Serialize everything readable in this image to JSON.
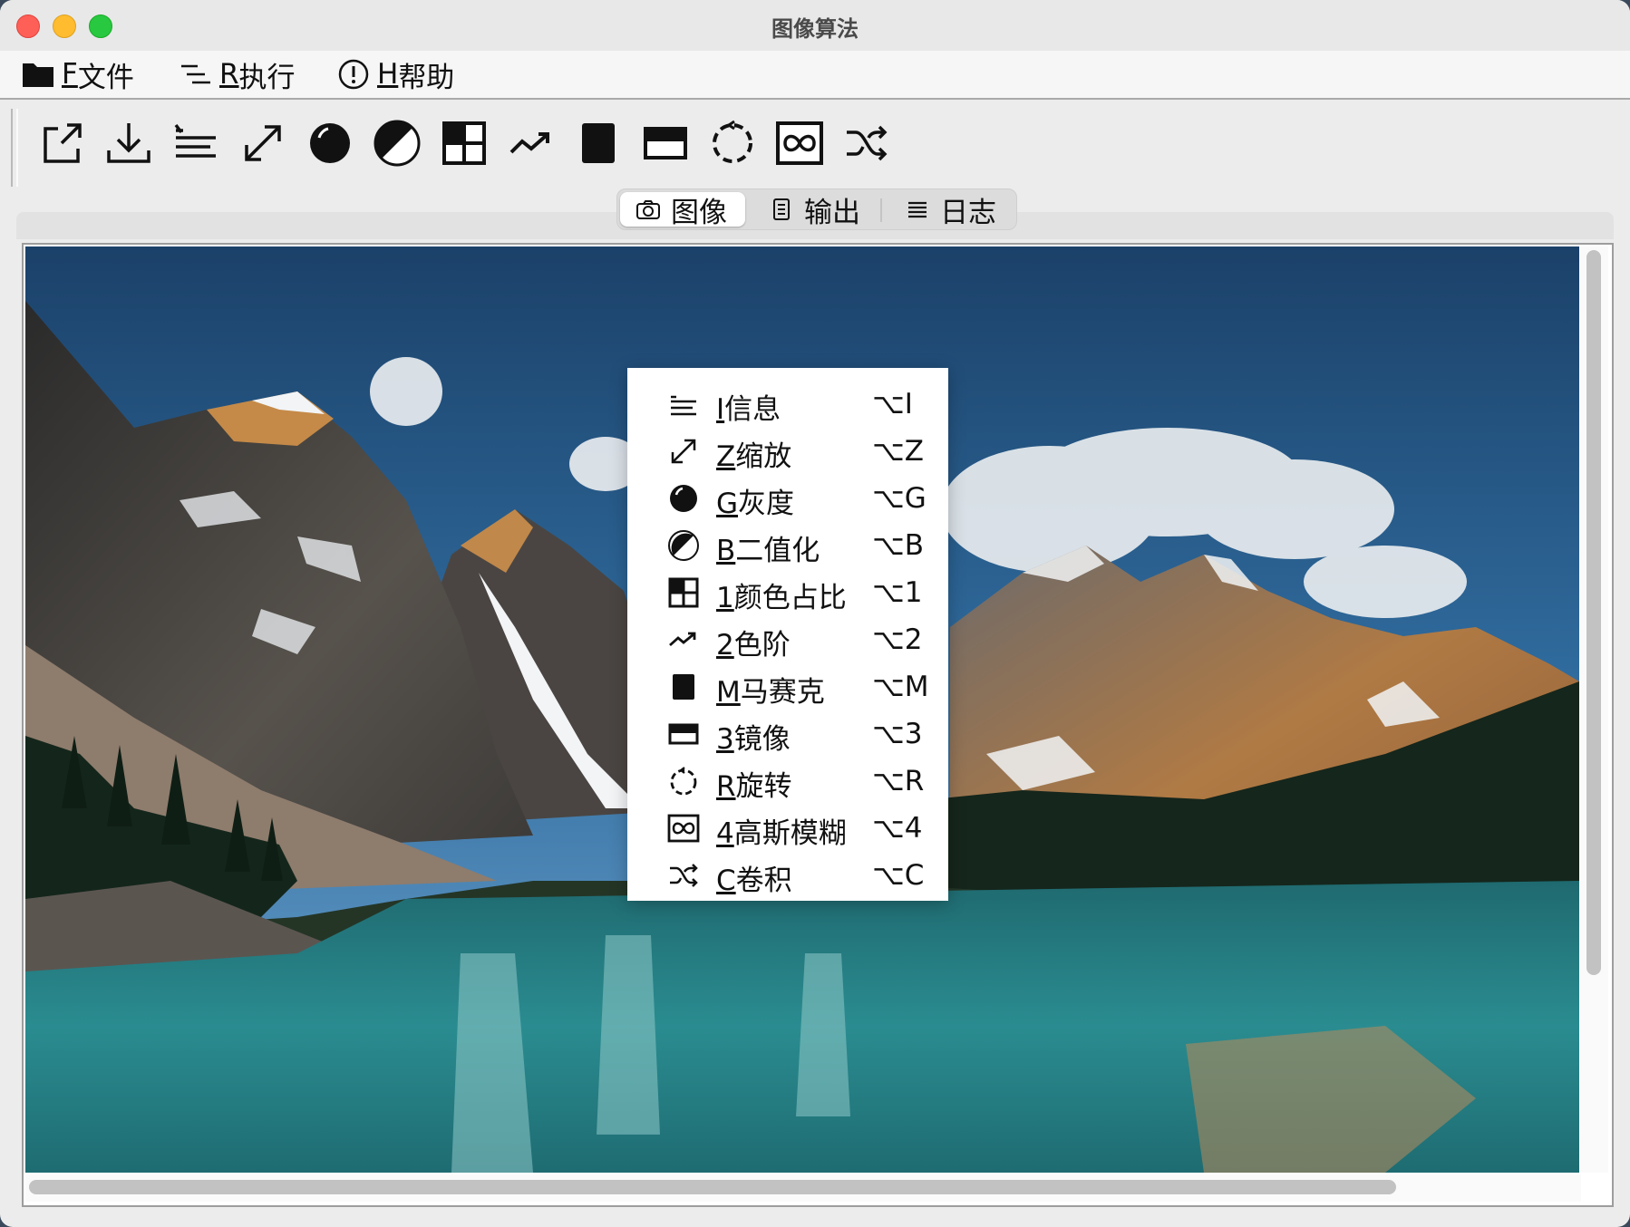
{
  "window": {
    "title": "图像算法",
    "colors": {
      "close": "#fe5f57",
      "minimize": "#febc2e",
      "maximize": "#28c840"
    }
  },
  "menubar": {
    "items": [
      {
        "accel": "F",
        "label": "文件",
        "icon": "folder-icon"
      },
      {
        "accel": "R",
        "label": "执行",
        "icon": "run-lines-icon"
      },
      {
        "accel": "H",
        "label": "帮助",
        "icon": "help-circle-icon"
      }
    ]
  },
  "toolbar": {
    "buttons": [
      {
        "name": "open-external-icon"
      },
      {
        "name": "download-icon"
      },
      {
        "name": "info-list-icon"
      },
      {
        "name": "resize-arrows-icon"
      },
      {
        "name": "grayscale-circle-icon"
      },
      {
        "name": "binarize-half-circle-icon"
      },
      {
        "name": "color-ratio-grid-icon"
      },
      {
        "name": "levels-trend-icon"
      },
      {
        "name": "mosaic-square-icon"
      },
      {
        "name": "mirror-rect-icon"
      },
      {
        "name": "rotate-dashed-circle-icon"
      },
      {
        "name": "gaussian-blur-icon"
      },
      {
        "name": "convolution-shuffle-icon"
      }
    ]
  },
  "tabs": [
    {
      "label": "图像",
      "icon": "camera-icon",
      "active": true
    },
    {
      "label": "输出",
      "icon": "document-icon",
      "active": false
    },
    {
      "label": "日志",
      "icon": "list-lines-icon",
      "active": false
    }
  ],
  "context_menu": {
    "items": [
      {
        "accel": "I",
        "label": "信息",
        "shortcut": "⌥I",
        "icon": "info-list-icon"
      },
      {
        "accel": "Z",
        "label": "缩放",
        "shortcut": "⌥Z",
        "icon": "resize-arrows-icon"
      },
      {
        "accel": "G",
        "label": "灰度",
        "shortcut": "⌥G",
        "icon": "grayscale-circle-icon"
      },
      {
        "accel": "B",
        "label": "二值化",
        "shortcut": "⌥B",
        "icon": "binarize-half-circle-icon"
      },
      {
        "accel": "1",
        "label": "颜色占比",
        "shortcut": "⌥1",
        "icon": "color-ratio-grid-icon"
      },
      {
        "accel": "2",
        "label": "色阶",
        "shortcut": "⌥2",
        "icon": "levels-trend-icon"
      },
      {
        "accel": "M",
        "label": "马赛克",
        "shortcut": "⌥M",
        "icon": "mosaic-square-icon"
      },
      {
        "accel": "3",
        "label": "镜像",
        "shortcut": "⌥3",
        "icon": "mirror-rect-icon"
      },
      {
        "accel": "R",
        "label": "旋转",
        "shortcut": "⌥R",
        "icon": "rotate-dashed-circle-icon"
      },
      {
        "accel": "4",
        "label": "高斯模糊",
        "shortcut": "⌥4",
        "icon": "gaussian-blur-icon"
      },
      {
        "accel": "C",
        "label": "卷积",
        "shortcut": "⌥C",
        "icon": "convolution-shuffle-icon"
      }
    ]
  }
}
